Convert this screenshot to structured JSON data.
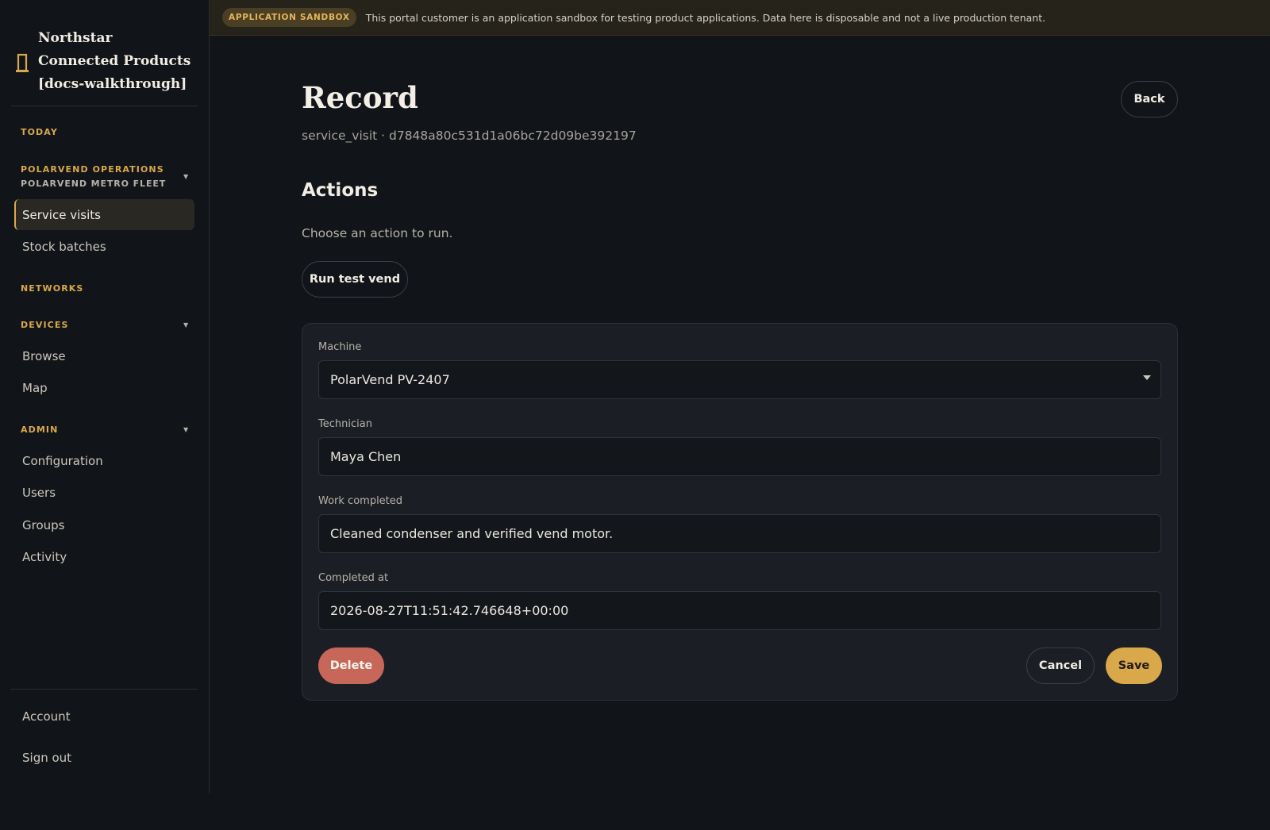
{
  "brand": {
    "name": "Northstar Connected Products [docs-walkthrough]",
    "icon": "vending-machine-icon",
    "accent_color": "#d9a84a"
  },
  "sidebar": {
    "today_label": "TODAY",
    "org_label": "POLARVEND OPERATIONS",
    "org_sub_label": "POLARVEND METRO FLEET",
    "org_items": [
      {
        "label": "Service visits",
        "active": true
      },
      {
        "label": "Stock batches",
        "active": false
      }
    ],
    "networks_label": "NETWORKS",
    "devices_label": "DEVICES",
    "devices_items": [
      {
        "label": "Browse"
      },
      {
        "label": "Map"
      }
    ],
    "admin_label": "ADMIN",
    "admin_items": [
      {
        "label": "Configuration"
      },
      {
        "label": "Users"
      },
      {
        "label": "Groups"
      },
      {
        "label": "Activity"
      }
    ],
    "account_label": "Account",
    "signout_label": "Sign out"
  },
  "banner": {
    "badge": "APPLICATION SANDBOX",
    "text": "This portal customer is an application sandbox for testing product applications. Data here is disposable and not a live production tenant."
  },
  "page": {
    "title": "Record",
    "subtitle": "service_visit · d7848a80c531d1a06bc72d09be392197",
    "back_label": "Back"
  },
  "actions": {
    "title": "Actions",
    "description": "Choose an action to run.",
    "run_label": "Run test vend"
  },
  "form": {
    "machine_label": "Machine",
    "machine_value": "PolarVend PV-2407",
    "technician_label": "Technician",
    "technician_value": "Maya Chen",
    "work_label": "Work completed",
    "work_value": "Cleaned condenser and verified vend motor.",
    "completed_label": "Completed at",
    "completed_value": "2026-08-27T11:51:42.746648+00:00",
    "delete_label": "Delete",
    "cancel_label": "Cancel",
    "save_label": "Save"
  }
}
